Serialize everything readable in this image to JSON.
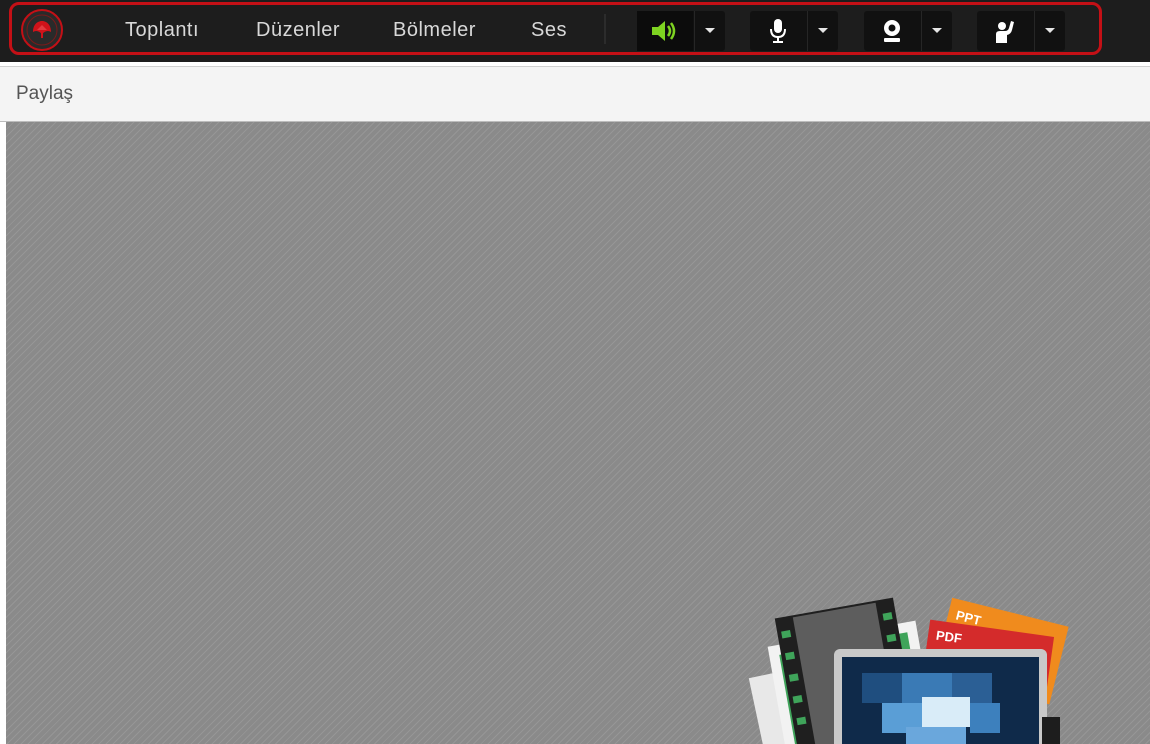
{
  "menu": {
    "items": [
      "Toplantı",
      "Düzenler",
      "Bölmeler",
      "Ses"
    ]
  },
  "controls": [
    {
      "name": "speaker",
      "icon": "speaker-icon",
      "active": true,
      "color": "#7ed321"
    },
    {
      "name": "microphone",
      "icon": "microphone-icon",
      "active": false,
      "color": "#ffffff"
    },
    {
      "name": "webcam",
      "icon": "webcam-icon",
      "active": false,
      "color": "#ffffff"
    },
    {
      "name": "raise-hand",
      "icon": "raise-hand-icon",
      "active": false,
      "color": "#ffffff"
    }
  ],
  "share": {
    "title": "Paylaş"
  },
  "illustration": {
    "ppt_label": "PPT",
    "pdf_label": "PDF"
  },
  "colors": {
    "highlight": "#c41016",
    "topbar": "#1d1d1d",
    "active_icon": "#7ed321"
  }
}
